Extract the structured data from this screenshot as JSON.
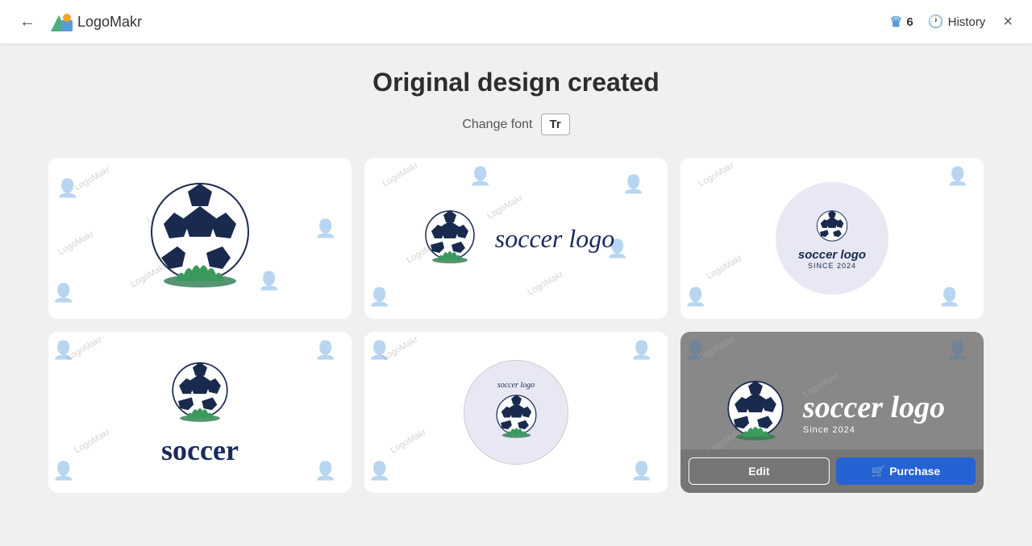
{
  "header": {
    "back_label": "←",
    "logo_text": "LogoMakr",
    "credits_count": "6",
    "history_label": "History",
    "close_label": "×"
  },
  "main": {
    "title": "Original design created",
    "font_change_label": "Change font",
    "font_btn_label": "Tr"
  },
  "cards": [
    {
      "id": "card-1",
      "type": "ball-only-large"
    },
    {
      "id": "card-2",
      "type": "ball-text-horizontal",
      "text": "soccer logo"
    },
    {
      "id": "card-3",
      "type": "ball-circle-frame",
      "text": "soccer logo",
      "sub": "Since 2024"
    },
    {
      "id": "card-4",
      "type": "ball-text-vertical",
      "text": "soccer"
    },
    {
      "id": "card-5",
      "type": "ball-small-circle",
      "text": "soccer logo"
    },
    {
      "id": "card-6",
      "type": "ball-dark-overlay",
      "text": "soccer logo",
      "sub": "Since 2024"
    }
  ],
  "actions": {
    "edit_label": "Edit",
    "purchase_label": "Purchase",
    "purchase_icon": "🛒"
  },
  "watermark": {
    "text": "LogoMakr"
  }
}
